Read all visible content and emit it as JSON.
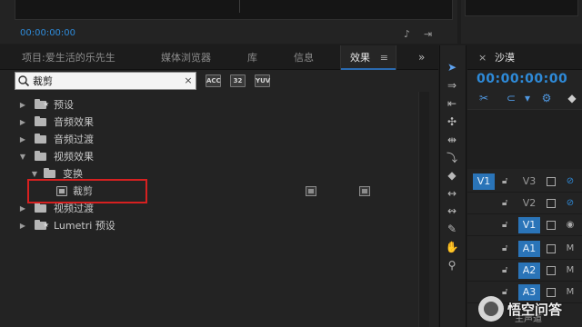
{
  "source_monitor": {
    "timecode": "00:00:00:00",
    "icons": [
      "wrench-icon",
      "export-icon"
    ]
  },
  "tabs": [
    {
      "label": "项目:爱生活的乐先生"
    },
    {
      "label": "媒体浏览器"
    },
    {
      "label": "库"
    },
    {
      "label": "信息"
    },
    {
      "label": "效果",
      "active": true,
      "menu": "≡"
    }
  ],
  "tabs_overflow": "»",
  "search": {
    "value": "裁剪",
    "clear": "×"
  },
  "filters": [
    "ACC",
    "32",
    "YUV"
  ],
  "tree": [
    {
      "label": "预设",
      "expanded": false,
      "icon": "preset-folder"
    },
    {
      "label": "音频效果",
      "expanded": false,
      "icon": "folder"
    },
    {
      "label": "音频过渡",
      "expanded": false,
      "icon": "folder"
    },
    {
      "label": "视频效果",
      "expanded": true,
      "icon": "folder"
    },
    {
      "label": "变换",
      "expanded": true,
      "icon": "folder"
    },
    {
      "label": "裁剪",
      "icon": "effect",
      "badges": [
        "accelerated",
        "yuv"
      ]
    },
    {
      "label": "视频过渡",
      "expanded": false,
      "icon": "folder"
    },
    {
      "label": "Lumetri 预设",
      "expanded": false,
      "icon": "preset-folder"
    }
  ],
  "tools": [
    "selection-tool-icon",
    "track-select-icon",
    "ripple-edit-icon",
    "rolling-edit-icon",
    "rate-stretch-icon",
    "razor-icon",
    "slip-icon",
    "slide-icon",
    "pen-icon",
    "hand-icon",
    "zoom-icon"
  ],
  "timeline": {
    "close": "×",
    "sequence_name": "沙漠",
    "timecode": "00:00:00:00",
    "tracks": [
      {
        "target": "V1",
        "target_on": true,
        "name": "V3",
        "name_on": false,
        "kind": "video"
      },
      {
        "target": "",
        "target_on": false,
        "name": "V2",
        "name_on": false,
        "kind": "video"
      },
      {
        "target": "",
        "target_on": false,
        "name": "V1",
        "name_on": true,
        "kind": "video"
      },
      {
        "target": "",
        "target_on": false,
        "name": "A1",
        "name_on": true,
        "kind": "audio",
        "mute": "M"
      },
      {
        "target": "",
        "target_on": false,
        "name": "A2",
        "name_on": true,
        "kind": "audio",
        "mute": "M"
      },
      {
        "target": "",
        "target_on": false,
        "name": "A3",
        "name_on": true,
        "kind": "audio",
        "mute": "M"
      }
    ],
    "master_label": "主声道"
  },
  "watermark": {
    "text": "悟空问答"
  }
}
